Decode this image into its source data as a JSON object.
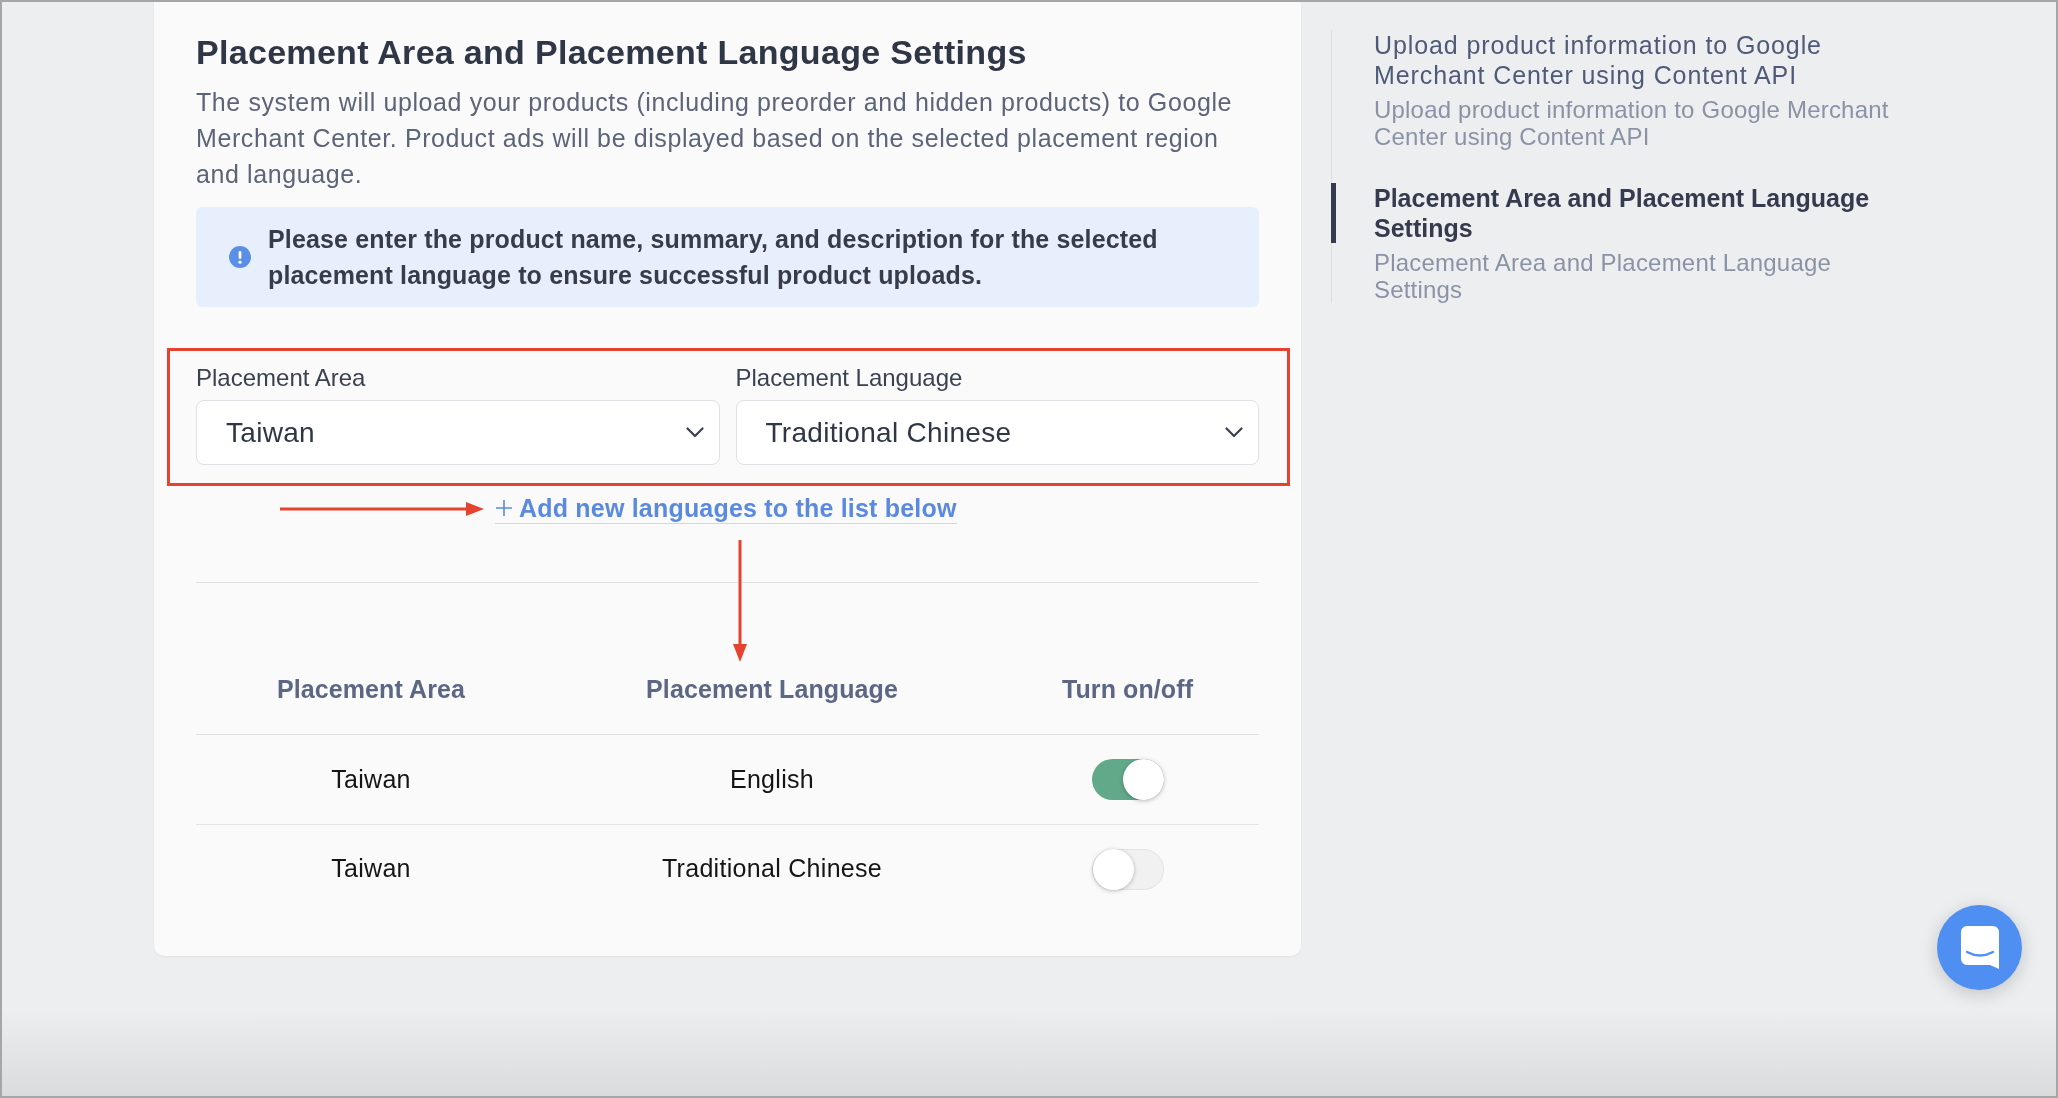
{
  "main": {
    "title": "Placement Area and Placement Language Settings",
    "description": "The system will upload your products (including preorder and hidden products) to Google Merchant Center. Product ads will be displayed based on the selected placement region and language.",
    "notice": "Please enter the product name, summary, and description for the selected placement language to ensure successful product uploads."
  },
  "form": {
    "fields": [
      {
        "label": "Placement Area",
        "value": "Taiwan"
      },
      {
        "label": "Placement Language",
        "value": "Traditional Chinese"
      }
    ],
    "add_link": "Add new languages to the list below"
  },
  "table": {
    "columns": [
      "Placement Area",
      "Placement Language",
      "Turn on/off"
    ],
    "rows": [
      {
        "area": "Taiwan",
        "language": "English",
        "on": true
      },
      {
        "area": "Taiwan",
        "language": "Traditional Chinese",
        "on": false
      }
    ]
  },
  "outline": {
    "items": [
      {
        "title": "Upload product information to Google Merchant Center using Content API",
        "subtitle": "Upload product information to Google Merchant Center using Content API",
        "selected": false
      },
      {
        "title": "Placement Area and Placement Language Settings",
        "subtitle": "Placement Area and Placement Language Settings",
        "selected": true
      }
    ]
  }
}
